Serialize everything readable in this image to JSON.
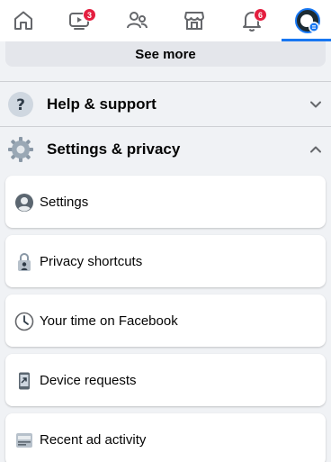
{
  "nav": {
    "items": [
      {
        "name": "home",
        "badge": ""
      },
      {
        "name": "watch",
        "badge": "3"
      },
      {
        "name": "friends",
        "badge": ""
      },
      {
        "name": "marketplace",
        "badge": ""
      },
      {
        "name": "notifications",
        "badge": "6"
      },
      {
        "name": "menu",
        "badge": ""
      }
    ],
    "active": "menu",
    "accent_color": "#1877f2",
    "badge_color": "#e41e3f"
  },
  "see_more": {
    "label": "See more"
  },
  "sections": {
    "help": {
      "label": "Help & support",
      "icon": "question-icon",
      "state": "collapsed"
    },
    "settings": {
      "label": "Settings & privacy",
      "icon": "gear-icon",
      "state": "expanded"
    }
  },
  "settings_items": [
    {
      "label": "Settings",
      "icon": "user-circle-icon"
    },
    {
      "label": "Privacy shortcuts",
      "icon": "lock-person-icon"
    },
    {
      "label": "Your time on Facebook",
      "icon": "clock-icon"
    },
    {
      "label": "Device requests",
      "icon": "phone-device-icon"
    },
    {
      "label": "Recent ad activity",
      "icon": "ad-activity-icon"
    }
  ]
}
